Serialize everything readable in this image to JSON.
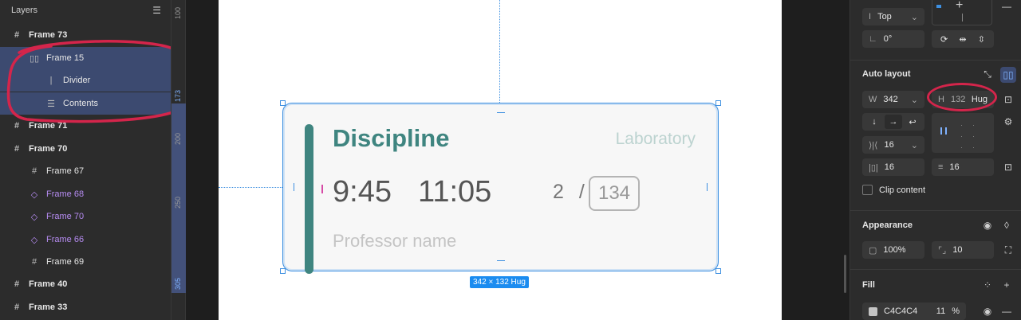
{
  "layers": {
    "title": "Layers",
    "items": [
      {
        "name": "Frame 73",
        "icon": "#"
      },
      {
        "name": "Frame 15",
        "icon": "▯▯"
      },
      {
        "name": "Divider",
        "icon": "|"
      },
      {
        "name": "Contents",
        "icon": "☰"
      },
      {
        "name": "Frame 71",
        "icon": "#"
      },
      {
        "name": "Frame 70",
        "icon": "#"
      },
      {
        "name": "Frame 67",
        "icon": "#"
      },
      {
        "name": "Frame 68",
        "icon": "◇"
      },
      {
        "name": "Frame 70",
        "icon": "◇"
      },
      {
        "name": "Frame 66",
        "icon": "◇"
      },
      {
        "name": "Frame 69",
        "icon": "#"
      },
      {
        "name": "Frame 40",
        "icon": "#"
      },
      {
        "name": "Frame 33",
        "icon": "#"
      }
    ]
  },
  "ruler": {
    "marks": [
      "100",
      "173",
      "200",
      "250",
      "305"
    ]
  },
  "card": {
    "title": "Discipline",
    "type": "Laboratory",
    "start": "9:45",
    "end": "11:05",
    "room_prefix": "2",
    "room_sep": "/",
    "room": "134",
    "professor": "Professor name"
  },
  "canvas": {
    "size_label": "342 × 132 Hug"
  },
  "props": {
    "align": {
      "label": "Top",
      "rotation": "0°"
    },
    "auto_layout": {
      "title": "Auto layout",
      "w_label": "W",
      "w_value": "342",
      "h_label": "H",
      "h_value": "132",
      "h_mode": "Hug",
      "gap": "16",
      "padding_h": "16",
      "padding_v": "16",
      "clip": "Clip content"
    },
    "appearance": {
      "title": "Appearance",
      "opacity": "100%",
      "radius": "10"
    },
    "fill": {
      "title": "Fill",
      "hex": "C4C4C4",
      "opacity": "11",
      "percent": "%"
    }
  },
  "colors": {
    "accent": "#3f8580",
    "selection": "#3d8fe0",
    "annotation": "#d4254b"
  }
}
